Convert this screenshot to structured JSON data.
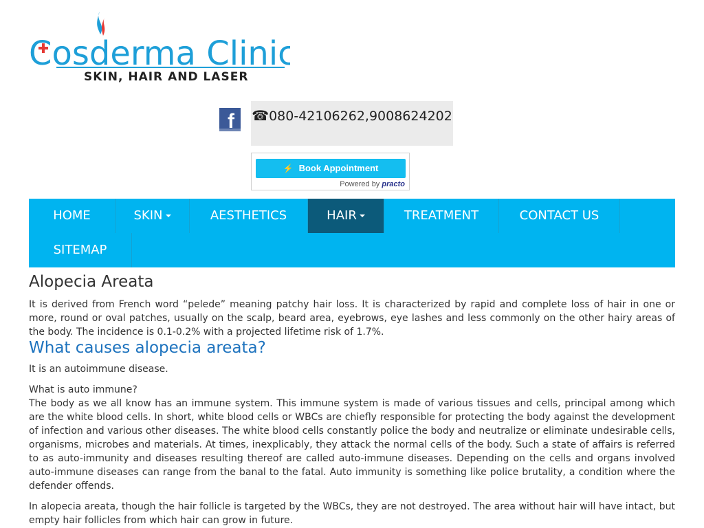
{
  "logo": {
    "brand": "Cosderma Clinic",
    "tagline": "SKIN, HAIR AND LASER"
  },
  "header": {
    "facebook_icon": "facebook-icon",
    "phone_icon": "☎",
    "phone_text": "080-42106262,9008624202",
    "book_label": "Book Appointment",
    "powered_by": "Powered by",
    "powered_brand": "practo"
  },
  "nav": {
    "items": [
      {
        "label": "HOME"
      },
      {
        "label": "SKIN"
      },
      {
        "label": "AESTHETICS"
      },
      {
        "label": "HAIR"
      },
      {
        "label": "TREATMENT"
      },
      {
        "label": "CONTACT US"
      },
      {
        "label": "SITEMAP"
      }
    ],
    "active": "HAIR"
  },
  "article": {
    "title": "Alopecia Areata",
    "intro": "It is derived from French word “pelede” meaning patchy hair loss. It is characterized by rapid and complete loss of hair in one or more, round or oval patches, usually on the scalp, beard area, eyebrows, eye lashes and less commonly on the other hairy areas of the body. The incidence is 0.1-0.2% with a projected lifetime risk of 1.7%.",
    "causes_heading": "What causes alopecia areata?",
    "autoimmune": "It is an autoimmune disease.",
    "question": "What is auto immune?",
    "body": "The body as we all know has an immune system. This immune system is made of various tissues and cells, principal among which are the white blood cells. In short, white blood cells or WBCs are chiefly responsible for protecting the body against the development of infection and various other diseases. The white blood cells constantly police the body and neutralize or eliminate undesirable cells, organisms, microbes and materials. At times, inexplicably, they attack the normal cells of the body. Such a state of affairs is referred to as auto-immunity and diseases resulting thereof are called auto-immune diseases. Depending on the cells and organs involved auto-immune diseases can range from the banal to the fatal. Auto immunity is something like police brutality, a condition where the defender offends.",
    "last": "In alopecia areata, though the hair follicle is targeted by the WBCs, they are not destroyed. The area without hair will have intact, but empty hair follicles from which hair can grow in future."
  },
  "colors": {
    "nav_bg": "#00b4f0",
    "nav_active": "#0c5a7a",
    "heading_blue": "#1e73be",
    "logo_blue": "#1e9fd8",
    "book_btn": "#14bef0"
  }
}
